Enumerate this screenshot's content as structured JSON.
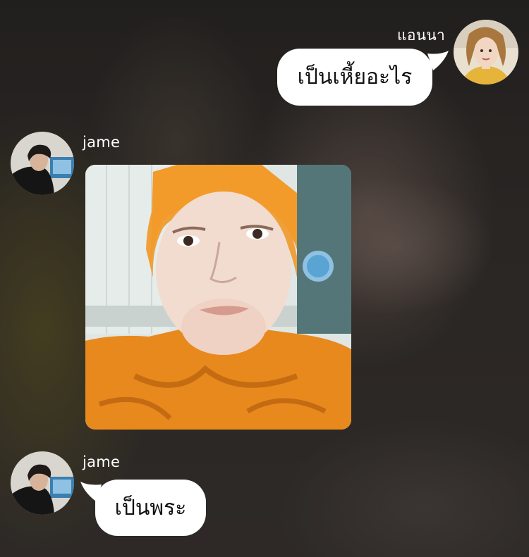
{
  "chat": {
    "messages": [
      {
        "sender": "แอนนา",
        "type": "text",
        "text": "เป็นเหี้ยอะไร",
        "side": "right",
        "avatar_icon": "woman-avatar-icon"
      },
      {
        "sender": "jame",
        "type": "image",
        "image_icon": "orange-robed-face-photo",
        "side": "left",
        "avatar_icon": "man-avatar-icon"
      },
      {
        "sender": "jame",
        "type": "text",
        "text": "เป็นพระ",
        "side": "left",
        "avatar_icon": "man-avatar-icon"
      }
    ]
  },
  "colors": {
    "bubble": "#ffffff",
    "name_text": "#ffffff",
    "robe_orange": "#e8891e"
  }
}
